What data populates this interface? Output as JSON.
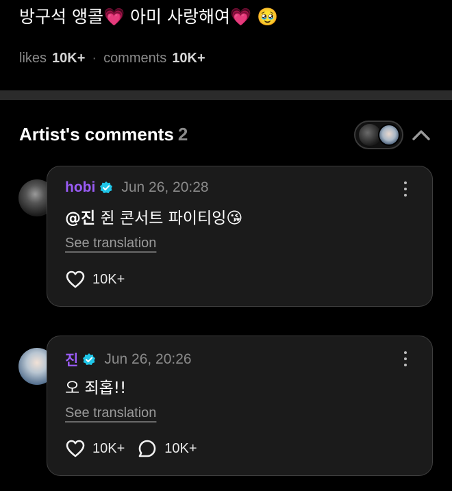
{
  "post": {
    "text": "방구석 앵콜💗 아미 사랑해여💗 🥹",
    "likes_label": "likes",
    "likes_count": "10K+",
    "comments_label": "comments",
    "comments_count": "10K+"
  },
  "artist_comments": {
    "title": "Artist's comments",
    "count": "2"
  },
  "comments": [
    {
      "author": "hobi",
      "timestamp": "Jun 26, 20:28",
      "mention": "@진",
      "text": " 쥔 콘서트 파이티잉😘",
      "see_translation": "See translation",
      "likes": "10K+"
    },
    {
      "author": "진",
      "timestamp": "Jun 26, 20:26",
      "text": "오 죄홉!!",
      "see_translation": "See translation",
      "likes": "10K+",
      "replies": "10K+"
    }
  ],
  "icons": [
    "verified-badge-icon",
    "heart-icon",
    "reply-bubble-icon",
    "more-vertical-icon",
    "chevron-up-icon"
  ],
  "colors": {
    "background": "#000000",
    "card": "#1b1b1b",
    "author": "#9a5cf6",
    "verified": "#1fc6e8",
    "muted": "#8a8a8a"
  }
}
